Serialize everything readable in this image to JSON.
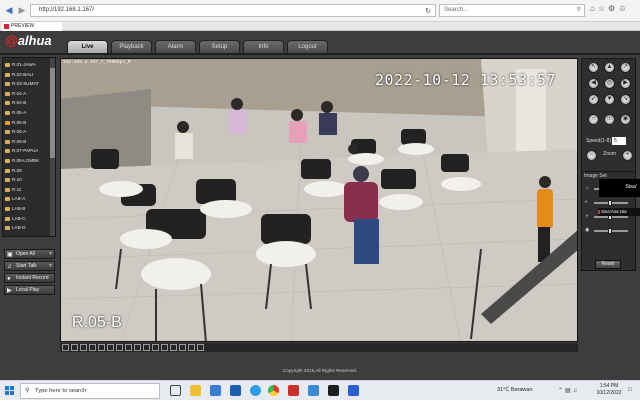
{
  "browser": {
    "url": "http://192.168.1.167/",
    "search_placeholder": "Search...",
    "tab_title": "PREVIEW"
  },
  "app": {
    "logo_text": "alhua",
    "tabs": [
      "Live",
      "Playback",
      "Alarm",
      "Setup",
      "Info",
      "Logout"
    ],
    "active_tab": "Live"
  },
  "channels": [
    {
      "label": "R.01-JAWA",
      "m": "M"
    },
    {
      "label": "R.02-BALI",
      "m": "M"
    },
    {
      "label": "R.03-SUMAT",
      "m": "M"
    },
    {
      "label": "R.04-A",
      "m": ""
    },
    {
      "label": "R.04-B",
      "m": ""
    },
    {
      "label": "R.05-A",
      "m": ""
    },
    {
      "label": "R.05-B",
      "m": "M"
    },
    {
      "label": "R.06-A",
      "m": "M"
    },
    {
      "label": "R.06-B",
      "m": "M"
    },
    {
      "label": "R.07-PAPUA",
      "m": ""
    },
    {
      "label": "R.08-LOMBK",
      "m": ""
    },
    {
      "label": "R.09",
      "m": ""
    },
    {
      "label": "R.10",
      "m": ""
    },
    {
      "label": "R.11",
      "m": ""
    },
    {
      "label": "LAB-A",
      "m": "M"
    },
    {
      "label": "LAB-B",
      "m": "M"
    },
    {
      "label": "LAB-C",
      "m": ""
    },
    {
      "label": "LAB-D",
      "m": ""
    },
    {
      "label": "LAB-JRGN",
      "m": ""
    }
  ],
  "selected_channel": "R.05-B",
  "left_buttons": {
    "open_all": "Open All",
    "start_talk": "Start Talk",
    "instant_record": "Instant Record",
    "local_play": "Local Play"
  },
  "video": {
    "info": "192.168.2.167_7_768Kbps_M",
    "timestamp": "2022-10-12  13:53:57",
    "camera_label": "R.05-B"
  },
  "ptz": {
    "speed_label": "Speed(1-8)",
    "speed_value": "5",
    "zoom_label": "Zoom",
    "focus_label": "Focus",
    "iris_label": "Iris"
  },
  "image_panel": {
    "title": "Image Set",
    "reset_label": "Reset"
  },
  "overlay": {
    "name_box": "Sisa'",
    "name_small": "Sisa'Ana Hia"
  },
  "copyright": "Copyright 2015,All Rights Reserved.",
  "taskbar": {
    "search_placeholder": "Type here to search",
    "weather": "31°C  Berawan",
    "time": "1:54 PM",
    "date": "10/12/2022"
  }
}
